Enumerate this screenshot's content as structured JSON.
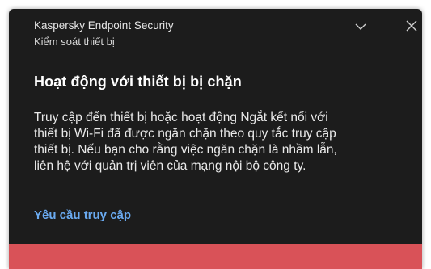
{
  "notification": {
    "app_name": "Kaspersky Endpoint Security",
    "component_name": "Kiểm soát thiết bị",
    "title": "Hoạt động với thiết bị bị chặn",
    "message": "Truy cập đến thiết bị hoặc hoạt động Ngắt kết nối với\nthiết bị Wi-Fi đã được ngăn chặn theo quy tắc truy cập\nthiết bị. Nếu bạn cho rằng việc ngăn chặn là nhầm lẫn,\nliên hệ với quản trị viên của mạng nội bộ công ty.",
    "request_access_link": "Yêu cầu truy cập",
    "collapse_icon": "chevron-down-icon",
    "close_icon": "close-icon"
  },
  "colors": {
    "background": "#1c1c1c",
    "link": "#6aaaf0",
    "status_bar": "#d95258"
  }
}
